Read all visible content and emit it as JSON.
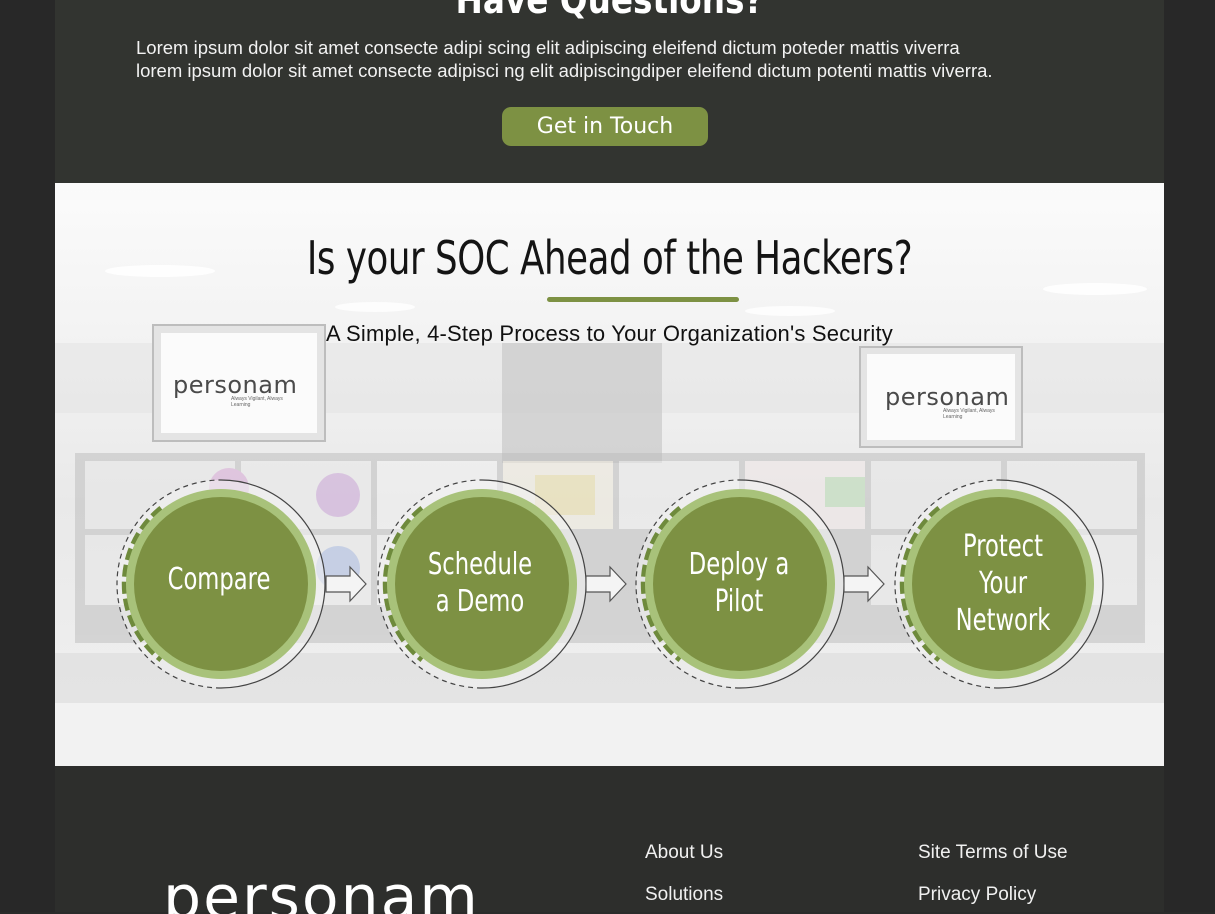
{
  "cta": {
    "title": "Have Questions?",
    "text_line1": "Lorem ipsum dolor sit amet consecte adipi scing elit adipiscing eleifend dictum poteder mattis viverra",
    "text_line2": "lorem ipsum dolor sit amet consecte adipisci ng elit adipiscingdiper eleifend dictum potenti mattis viverra.",
    "button_label": "Get in Touch"
  },
  "process": {
    "title": "Is your SOC Ahead of the Hackers?",
    "subtitle": "A Simple, 4-Step Process to Your Organization's Security",
    "monitor_brand": "personam",
    "monitor_tagline": "Always Vigilant, Always Learning",
    "steps": [
      {
        "line1": "Compare",
        "line2": "",
        "line3": ""
      },
      {
        "line1": "Schedule",
        "line2": "a Demo",
        "line3": ""
      },
      {
        "line1": "Deploy a",
        "line2": "Pilot",
        "line3": ""
      },
      {
        "line1": "Protect",
        "line2": "Your",
        "line3": "Network"
      }
    ]
  },
  "footer": {
    "logo_text": "personam",
    "links_col1": [
      "About Us",
      "Solutions"
    ],
    "links_col2": [
      "Site Terms of Use",
      "Privacy Policy"
    ]
  },
  "colors": {
    "accent_green": "#7d9143",
    "dark_bg": "#323430"
  }
}
